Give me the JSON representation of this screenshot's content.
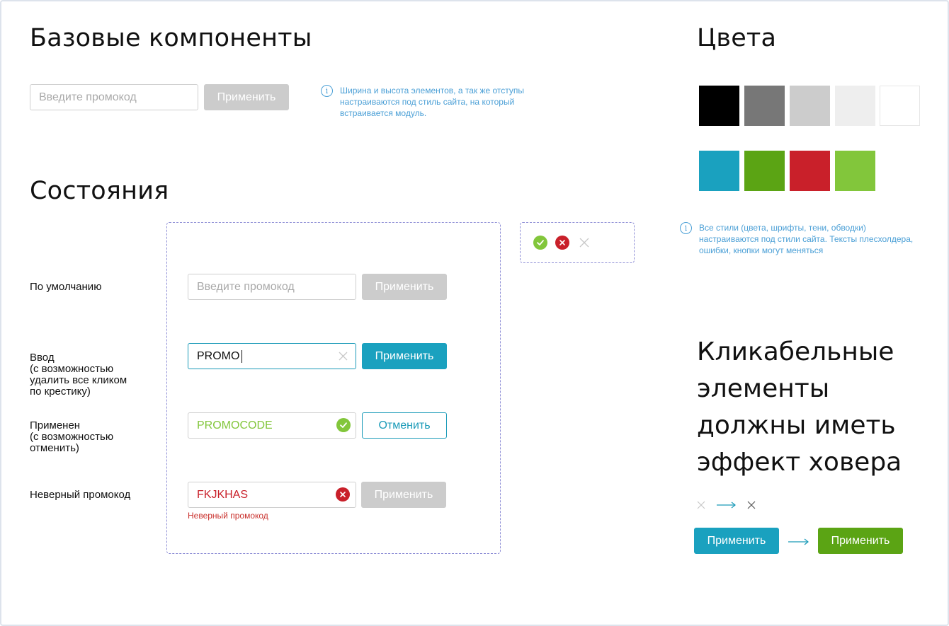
{
  "base": {
    "title": "Базовые компоненты",
    "input_placeholder": "Введите промокод",
    "apply_label": "Применить",
    "info_text": "Ширина и высота элементов, а так же отступы настраиваются под стиль сайта, на который встраивается модуль."
  },
  "states": {
    "title": "Состояния",
    "rows": [
      {
        "label": "По умолчанию",
        "input": "Введите промокод",
        "button": "Применить"
      },
      {
        "label": "Ввод\n(с возможностью\nудалить все кликом\nпо крестику)",
        "input": "PROMO",
        "button": "Применить"
      },
      {
        "label": "Применен\n(с возможностью\nотменить)",
        "input": "PROMOCODE",
        "button": "Отменить"
      },
      {
        "label": "Неверный промокод",
        "input": "FKJKHAS",
        "button": "Применить",
        "error": "Неверный промокод"
      }
    ]
  },
  "colors": {
    "title": "Цвета",
    "row1": [
      "#000000",
      "#777777",
      "#cccccc",
      "#eeeeee",
      "#ffffff"
    ],
    "row2": [
      "#1aa1bf",
      "#5ba414",
      "#c9202a",
      "#82c63b"
    ],
    "info_text": "Все стили (цвета, шрифты, тени, обводки) настраиваются под стили сайта. Тексты плесхолдера, ошибки, кнопки могут меняться"
  },
  "icons": [
    "check-icon",
    "error-icon",
    "close-icon"
  ],
  "hover": {
    "title_lines": [
      "Кликабельные",
      "элементы",
      "должны иметь",
      "эффект ховера"
    ],
    "button_before": "Применить",
    "button_after": "Применить"
  }
}
